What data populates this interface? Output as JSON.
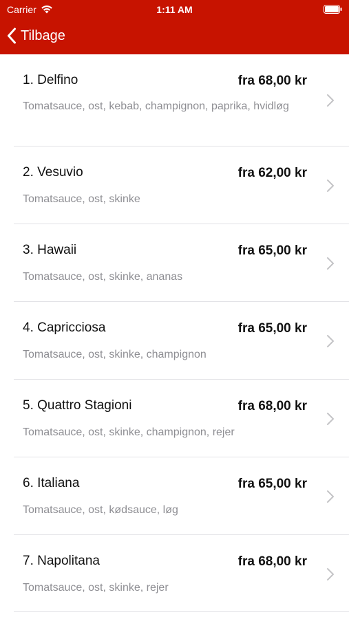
{
  "status_bar": {
    "carrier": "Carrier",
    "time": "1:11 AM"
  },
  "nav": {
    "back_label": "Tilbage"
  },
  "colors": {
    "header_bg": "#c71300",
    "secondary_text": "#8e8e93"
  },
  "menu_items": [
    {
      "title": "1. Delfino",
      "price": "fra 68,00 kr",
      "description": "Tomatsauce, ost, kebab, champignon, paprika, hvidløg"
    },
    {
      "title": "2. Vesuvio",
      "price": "fra 62,00 kr",
      "description": "Tomatsauce, ost, skinke"
    },
    {
      "title": "3. Hawaii",
      "price": "fra 65,00 kr",
      "description": "Tomatsauce, ost, skinke, ananas"
    },
    {
      "title": "4. Capricciosa",
      "price": "fra 65,00 kr",
      "description": "Tomatsauce, ost, skinke, champignon"
    },
    {
      "title": "5. Quattro Stagioni",
      "price": "fra 68,00 kr",
      "description": "Tomatsauce, ost, skinke, champignon, rejer"
    },
    {
      "title": "6. Italiana",
      "price": "fra 65,00 kr",
      "description": "Tomatsauce, ost, kødsauce, løg"
    },
    {
      "title": "7. Napolitana",
      "price": "fra 68,00 kr",
      "description": "Tomatsauce, ost, skinke, rejer"
    }
  ]
}
